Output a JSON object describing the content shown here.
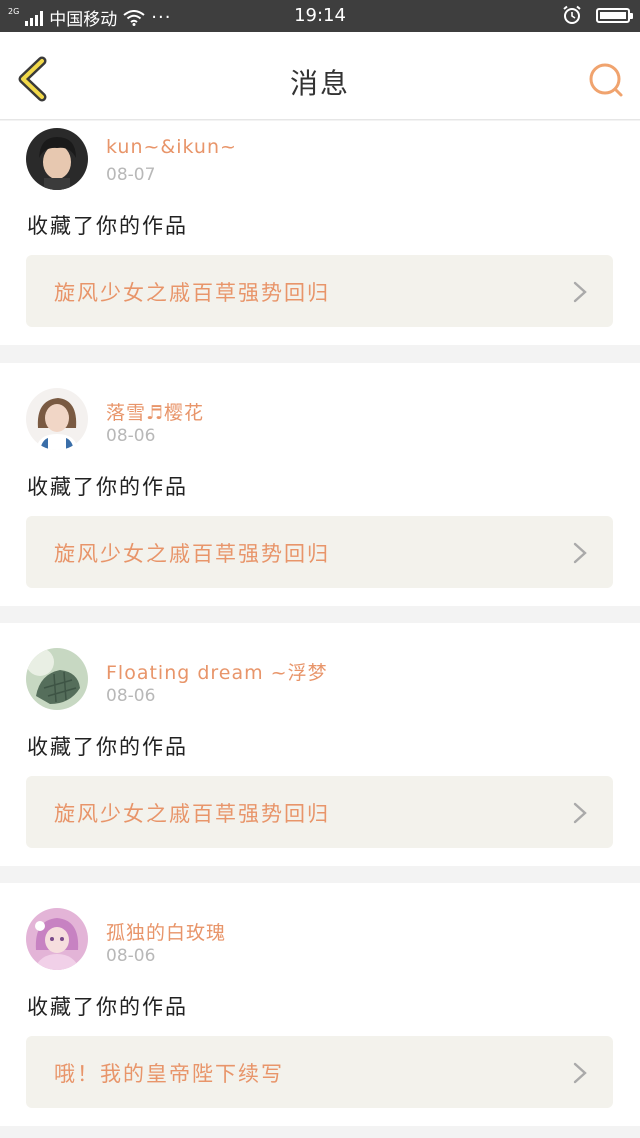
{
  "status_bar": {
    "network": "2G",
    "carrier": "中国移动",
    "dots": "···",
    "time": "19:14",
    "battery_level": 1.0
  },
  "nav": {
    "title": "消息",
    "back_icon": "chevron-left-icon",
    "search_icon": "search-icon",
    "accent_color": "#f0a36e"
  },
  "messages": [
    {
      "username": "kun~&ikun~",
      "date": "08-07",
      "action": "收藏了你的作品",
      "work_title": "旋风少女之戚百草强势回归"
    },
    {
      "username": "落雪♬樱花",
      "date": "08-06",
      "action": "收藏了你的作品",
      "work_title": "旋风少女之戚百草强势回归"
    },
    {
      "username": "Floating dream ~浮梦",
      "date": "08-06",
      "action": "收藏了你的作品",
      "work_title": "旋风少女之戚百草强势回归"
    },
    {
      "username": "孤独的白玫瑰",
      "date": "08-06",
      "action": "收藏了你的作品",
      "work_title": "哦！我的皇帝陛下续写"
    }
  ],
  "colors": {
    "username": "#e8956a",
    "date": "#b8b8b8",
    "work_bg": "#f3f2ec",
    "page_bg": "#f3f3f3"
  }
}
